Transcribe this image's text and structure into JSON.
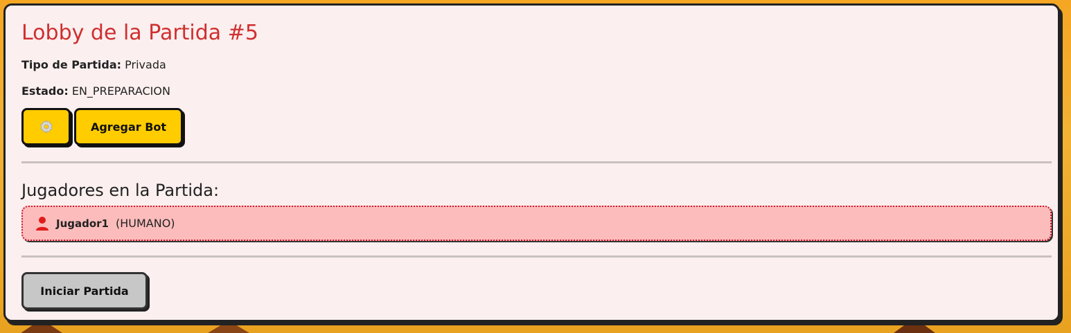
{
  "lobby": {
    "title": "Lobby de la Partida #5",
    "tipo_label": "Tipo de Partida:",
    "tipo_value": "Privada",
    "estado_label": "Estado:",
    "estado_value": "EN_PREPARACION"
  },
  "actions": {
    "settings_icon": "gear-icon",
    "agregar_bot_label": "Agregar Bot"
  },
  "players_section": {
    "title": "Jugadores en la Partida:",
    "players": [
      {
        "name": "Jugador1",
        "type": "(HUMANO)",
        "icon": "user-icon"
      }
    ]
  },
  "footer": {
    "iniciar_label": "Iniciar Partida"
  },
  "colors": {
    "title": "#cf2f2f",
    "button_yellow": "#ffcc00",
    "player_bg": "#fcbcbc",
    "panel_bg": "#fcefef"
  }
}
